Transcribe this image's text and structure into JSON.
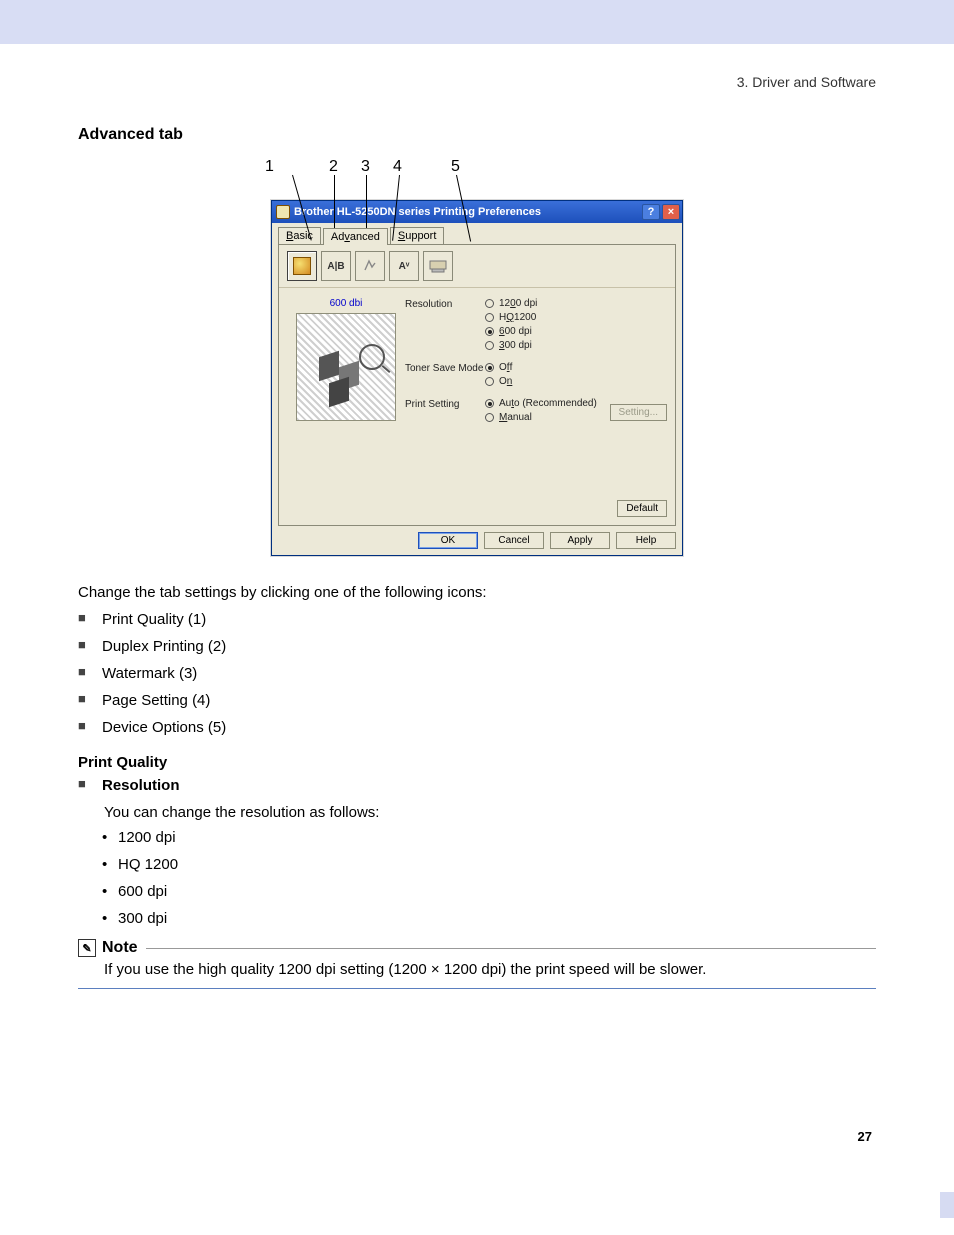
{
  "chapter": "3. Driver and Software",
  "heading": "Advanced tab",
  "callouts": [
    "1",
    "2",
    "3",
    "4",
    "5"
  ],
  "dialog": {
    "title": "Brother HL-5250DN series Printing Preferences",
    "help_btn": "?",
    "close_btn": "×",
    "tabs": {
      "basic": "Basic",
      "basic_u": "B",
      "advanced": "Advanced",
      "advanced_u": "v",
      "support": "Support",
      "support_u": "S"
    },
    "tool_icons": {
      "duplex": "A|B",
      "font": "Aᵛ"
    },
    "preview_res": "600 dbi",
    "resolution_label": "Resolution",
    "resolution_options": {
      "r1200": "1200 dpi",
      "r1200_u": "0",
      "hq1200": "HQ 1200",
      "hq1200_u": "Q",
      "r600": "600 dpi",
      "r600_u": "6",
      "r300": "300 dpi",
      "r300_u": "3"
    },
    "toner_label": "Toner Save Mode",
    "toner_options": {
      "off": "Off",
      "off_u": "f",
      "on": "On",
      "on_u": "n"
    },
    "print_label": "Print Setting",
    "print_options": {
      "auto": "Auto (Recommended)",
      "auto_u": "t",
      "manual": "Manual",
      "manual_u": "M"
    },
    "setting_btn": "Setting...",
    "default_btn": "Default",
    "footer": {
      "ok": "OK",
      "cancel": "Cancel",
      "apply": "Apply",
      "apply_u": "A",
      "help": "Help"
    }
  },
  "intro": "Change the tab settings by clicking one of the following icons:",
  "icon_list": [
    "Print Quality (1)",
    "Duplex Printing (2)",
    "Watermark (3)",
    "Page Setting (4)",
    "Device Options (5)"
  ],
  "pq_heading": "Print Quality",
  "res_heading": "Resolution",
  "res_intro": "You can change the resolution as follows:",
  "res_list": [
    "1200 dpi",
    "HQ 1200",
    "600 dpi",
    "300 dpi"
  ],
  "note_label": "Note",
  "note_body": "If you use the high quality 1200 dpi setting (1200 × 1200 dpi) the print speed will be slower.",
  "page_number": "27"
}
